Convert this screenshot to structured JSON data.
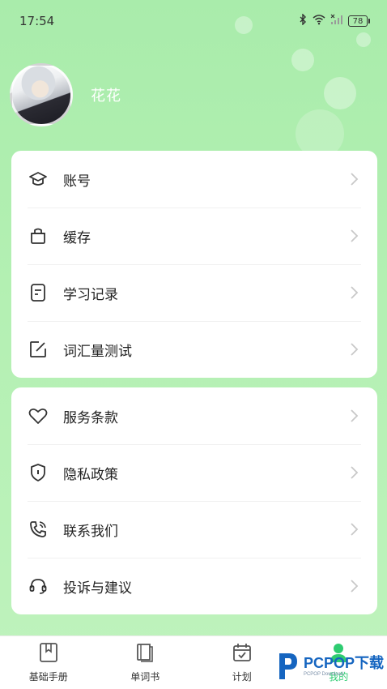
{
  "status_bar": {
    "time": "17:54",
    "battery": "78",
    "icons": [
      "bluetooth-icon",
      "wifi-icon",
      "signal-icon",
      "battery-icon"
    ]
  },
  "profile": {
    "username": "花花"
  },
  "menu_card_1": {
    "items": [
      {
        "label": "账号",
        "icon": "graduation-cap-icon"
      },
      {
        "label": "缓存",
        "icon": "bag-icon"
      },
      {
        "label": "学习记录",
        "icon": "document-icon"
      },
      {
        "label": "词汇量测试",
        "icon": "edit-icon"
      }
    ]
  },
  "menu_card_2": {
    "items": [
      {
        "label": "服务条款",
        "icon": "heart-icon"
      },
      {
        "label": "隐私政策",
        "icon": "shield-icon"
      },
      {
        "label": "联系我们",
        "icon": "phone-icon"
      },
      {
        "label": "投诉与建议",
        "icon": "headset-icon"
      }
    ]
  },
  "tabbar": {
    "tabs": [
      {
        "label": "基础手册",
        "icon": "bookmark-icon"
      },
      {
        "label": "单词书",
        "icon": "book-icon"
      },
      {
        "label": "计划",
        "icon": "calendar-check-icon"
      },
      {
        "label": "我的",
        "icon": "person-icon",
        "active": true
      }
    ]
  },
  "watermark": {
    "brand": "PCPOP下载",
    "sub": "PCPOP Download"
  },
  "colors": {
    "background": "#b4f0b3",
    "accent": "#2ecc71",
    "card": "#ffffff",
    "watermark": "#1565c0"
  }
}
